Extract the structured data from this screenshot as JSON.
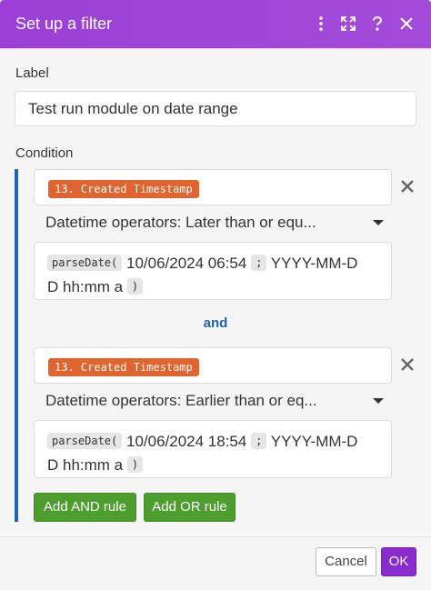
{
  "dialog": {
    "title": "Set up a filter",
    "icons": [
      "more-vertical-icon",
      "expand-icon",
      "help-icon",
      "close-icon"
    ]
  },
  "label": {
    "caption": "Label",
    "value": "Test run module on date range"
  },
  "condition": {
    "caption": "Condition",
    "rules": [
      {
        "field": "13. Created Timestamp",
        "operator": "Datetime operators: Later than or equ...",
        "fn": "parseDate(",
        "date": "10/06/2024 06:54",
        "sep": ";",
        "format_part1": "YYYY-MM-D",
        "format_part2": "D hh:mm a",
        "close": ")"
      },
      {
        "field": "13. Created Timestamp",
        "operator": "Datetime operators: Earlier than or eq...",
        "fn": "parseDate(",
        "date": "10/06/2024 18:54",
        "sep": ";",
        "format_part1": "YYYY-MM-D",
        "format_part2": "D hh:mm a",
        "close": ")"
      }
    ],
    "joiner": "and"
  },
  "buttons": {
    "add_and": "Add AND rule",
    "add_or": "Add OR rule",
    "cancel": "Cancel",
    "ok": "OK"
  },
  "colors": {
    "header": "#9b3fd6",
    "field_pill": "#e0642f",
    "accent_blue": "#1e63b5",
    "green": "#4e9e2f",
    "ok": "#8a2bcf"
  }
}
